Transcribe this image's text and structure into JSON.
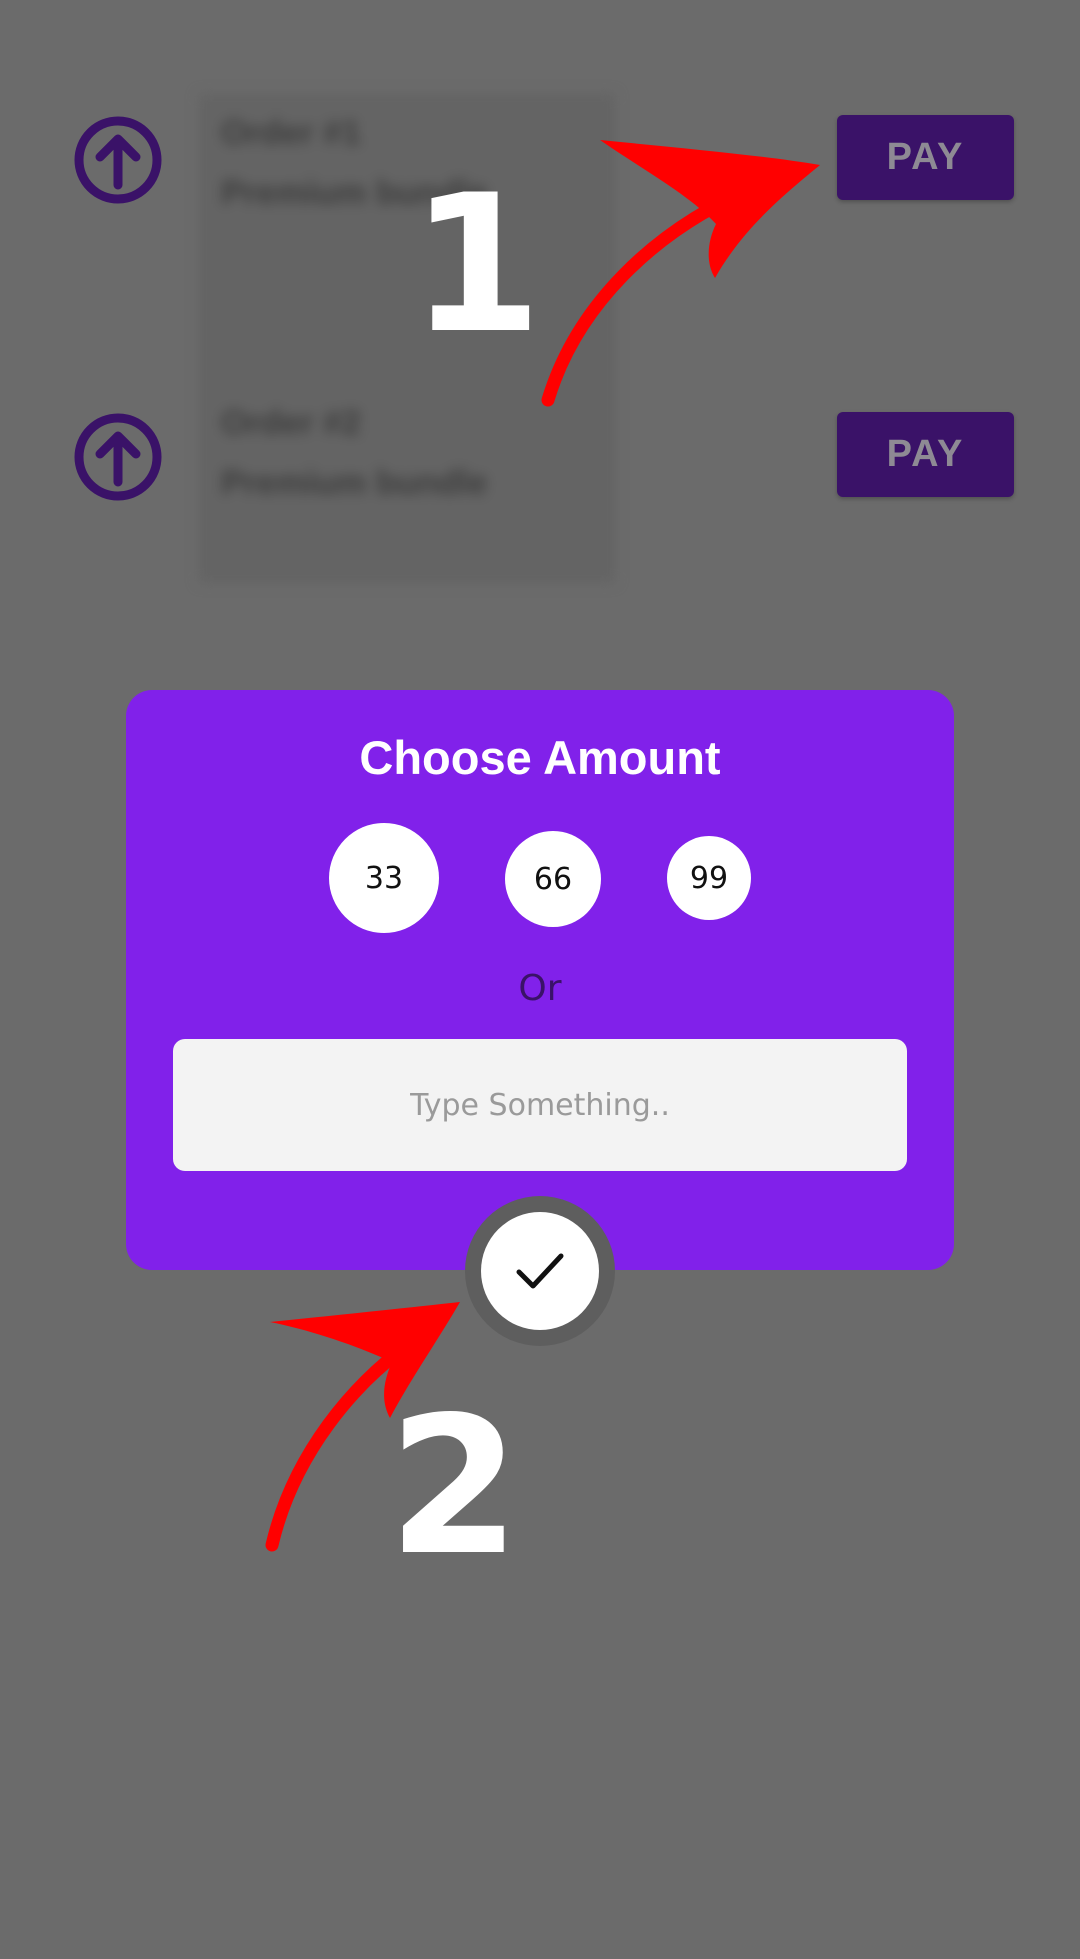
{
  "list": {
    "rows": [
      {
        "pay_label": "PAY",
        "upload_icon": "upload-arrow-circle-icon"
      },
      {
        "pay_label": "PAY",
        "upload_icon": "upload-arrow-circle-icon"
      }
    ]
  },
  "blurred_card": {
    "lines": [
      "Order #1",
      "Premium bundle",
      "Order #2",
      "Premium bundle"
    ]
  },
  "annotations": {
    "step1": "1",
    "step2": "2",
    "arrow_color": "#ff0000"
  },
  "dialog": {
    "title": "Choose Amount",
    "amounts": [
      "33",
      "66",
      "99"
    ],
    "or_label": "Or",
    "input_placeholder": "Type Something..",
    "input_value": "",
    "confirm_icon": "checkmark-icon"
  },
  "colors": {
    "background": "#6b6b6b",
    "dialog_bg": "#8121ea",
    "pay_button_bg": "#3a1268",
    "upload_icon": "#3a1268",
    "chip_bg": "#ffffff",
    "input_bg": "#f3f3f3"
  }
}
